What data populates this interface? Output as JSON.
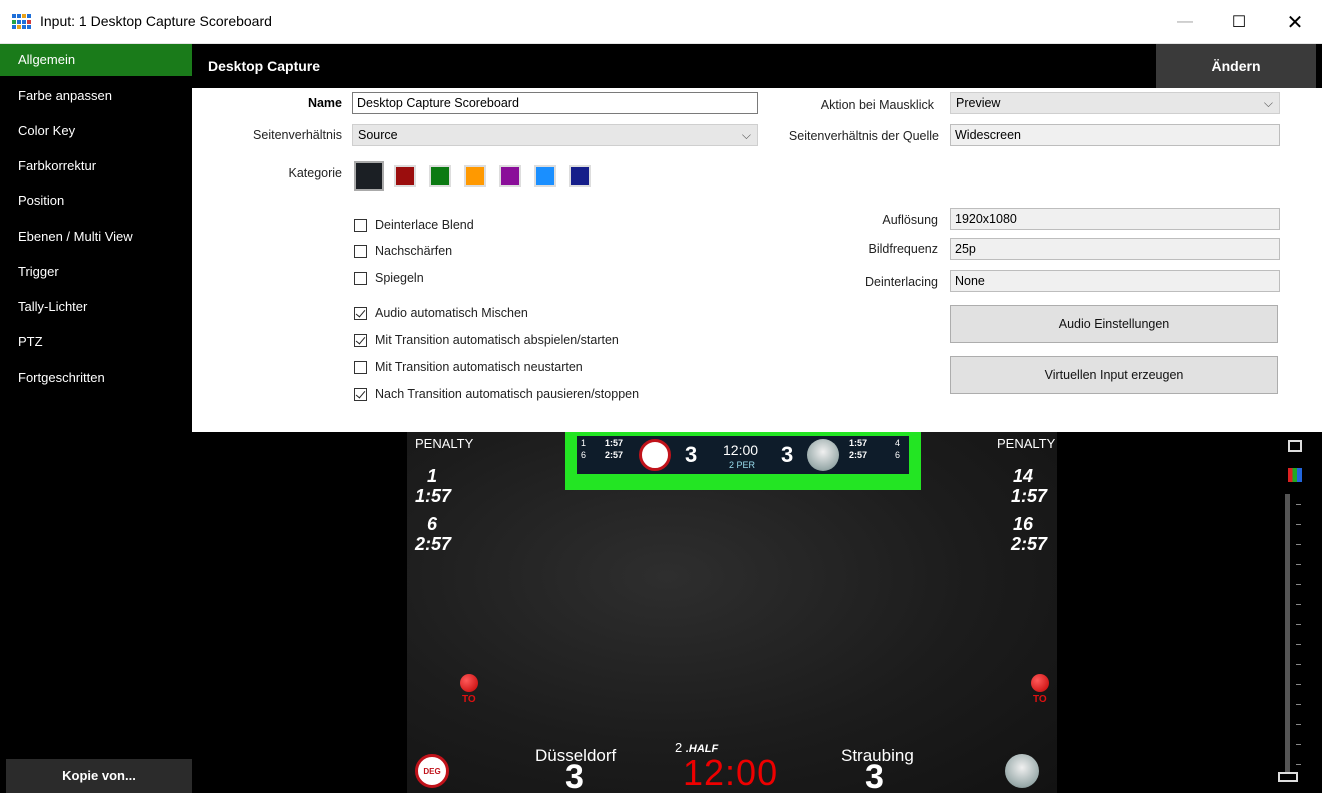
{
  "window": {
    "title": "Input: 1 Desktop Capture Scoreboard",
    "minimize": "—",
    "maximize": "☐",
    "close": "✕",
    "icon_colors": [
      "#1e6fd9",
      "#e8a21a",
      "#22a34a",
      "#d23b3b"
    ]
  },
  "sidebar": {
    "items": [
      {
        "label": "Allgemein",
        "active": true
      },
      {
        "label": "Farbe anpassen"
      },
      {
        "label": "Color Key"
      },
      {
        "label": "Farbkorrektur"
      },
      {
        "label": "Position"
      },
      {
        "label": "Ebenen / Multi View"
      },
      {
        "label": "Trigger"
      },
      {
        "label": "Tally-Lichter"
      },
      {
        "label": "PTZ"
      },
      {
        "label": "Fortgeschritten"
      }
    ],
    "copy_button": "Kopie von..."
  },
  "header": {
    "title": "Desktop Capture",
    "change_button": "Ändern"
  },
  "form": {
    "name_label": "Name",
    "name_value": "Desktop Capture Scoreboard",
    "aspect_label": "Seitenverhältnis",
    "aspect_value": "Source",
    "category_label": "Kategorie",
    "category_colors": [
      "#1b1f24",
      "#9b0d0d",
      "#0b7a12",
      "#ff9900",
      "#8a0e99",
      "#1a8fff",
      "#151e8a"
    ],
    "mouse_action_label": "Aktion bei Mausklick",
    "mouse_action_value": "Preview",
    "source_aspect_label": "Seitenverhältnis der Quelle",
    "source_aspect_value": "Widescreen",
    "resolution_label": "Auflösung",
    "resolution_value": "1920x1080",
    "framerate_label": "Bildfrequenz",
    "framerate_value": "25p",
    "deinterlacing_label": "Deinterlacing",
    "deinterlacing_value": "None",
    "checkboxes": [
      {
        "label": "Deinterlace Blend",
        "checked": false
      },
      {
        "label": "Nachschärfen",
        "checked": false
      },
      {
        "label": "Spiegeln",
        "checked": false
      },
      {
        "label": "Audio automatisch Mischen",
        "checked": true
      },
      {
        "label": "Mit Transition automatisch abspielen/starten",
        "checked": true
      },
      {
        "label": "Mit Transition automatisch neustarten",
        "checked": false
      },
      {
        "label": "Nach Transition automatisch pausieren/stoppen",
        "checked": true
      }
    ],
    "audio_button": "Audio Einstellungen",
    "virtual_button": "Virtuellen Input erzeugen"
  },
  "preview": {
    "left_penalty": {
      "label": "PENALTY",
      "entries": [
        {
          "num": "1",
          "time": "1:57"
        },
        {
          "num": "6",
          "time": "2:57"
        }
      ]
    },
    "right_penalty": {
      "label": "PENALTY",
      "entries": [
        {
          "num": "14",
          "time": "1:57"
        },
        {
          "num": "16",
          "time": "2:57"
        }
      ]
    },
    "to_label": "TO",
    "home": {
      "name": "Düsseldorf",
      "score": "3"
    },
    "away": {
      "name": "Straubing",
      "score": "3"
    },
    "period_num": "2",
    "period_label": ".HALF",
    "clock": "12:00",
    "mini": {
      "home_pen1": "1:57",
      "home_pen2": "2:57",
      "home_pen1_num": "1",
      "home_pen2_num": "6",
      "away_pen1": "1:57",
      "away_pen2": "2:57",
      "away_pen1_num": "4",
      "away_pen2_num": "6",
      "home_score": "3",
      "away_score": "3",
      "clock": "12:00",
      "period": "2 PER"
    }
  }
}
